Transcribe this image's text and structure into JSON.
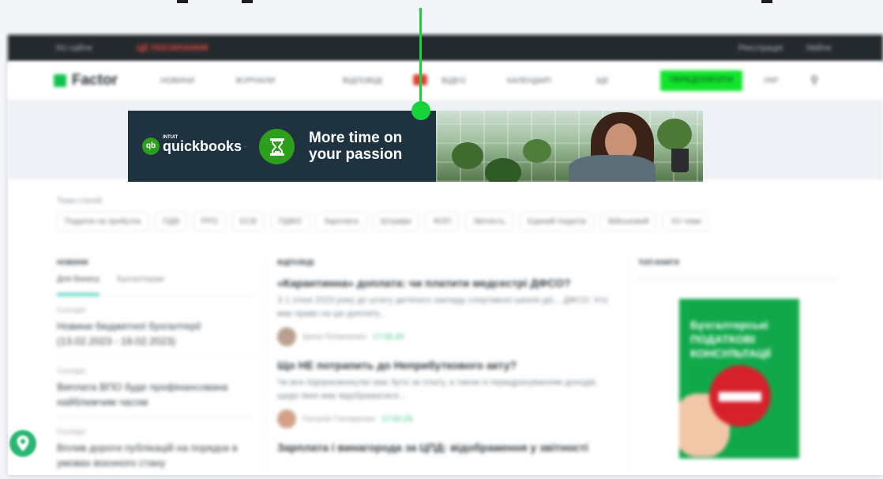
{
  "topbar": {
    "site_menu": "Усі сайти",
    "promo": "ЦЕ ПОСИЛАННЯ",
    "register": "Реєстрація",
    "login": "Увійти"
  },
  "nav": {
    "logo": "Factor",
    "items": [
      "НОВИНИ",
      "ЖУРНАЛИ",
      "ВІДПОВІДІ",
      "ВІДЕО",
      "КАЛЕНДАРІ",
      "ЩЕ"
    ],
    "cta": "ПЕРЕДПЛАТИТИ",
    "lang": "УКР"
  },
  "banner": {
    "brand_intuit": "INTUIT",
    "brand_name": "quickbooks",
    "brand_mark": "qb",
    "headline_line1": "More time on",
    "headline_line2": "your passion",
    "accent": "#2ca01c",
    "background": "#1f3240"
  },
  "tags": {
    "title": "Теми статей",
    "items": [
      "Податок на прибуток",
      "ПДВ",
      "РРО",
      "ЄСВ",
      "ПДФО",
      "Зарплата",
      "Штрафи",
      "ФОП",
      "Звітність",
      "Єдиний податок",
      "Військовий",
      "Усі теми"
    ]
  },
  "news": {
    "title": "НОВИНИ",
    "tabs": [
      "Для бізнесу",
      "Бухгалтерам"
    ],
    "items": [
      {
        "time": "Сьогодні",
        "text": "Новини бюджетної бухгалтерії (13.02.2023 - 19.02.2023)"
      },
      {
        "time": "Сьогодні",
        "text": "Виплата ВПО буде профінансована найближчим часом"
      },
      {
        "time": "Сьогодні",
        "text": "Вплив дороги публікацій на порядок в умовах воєнного стану"
      }
    ]
  },
  "answers": {
    "title": "ВІДПОВІДІ",
    "items": [
      {
        "q": "«Карантинна» доплата: чи платити медсестрі ДФСО?",
        "desc": "З 1 січня 2023 року до штату дитячого закладу спортивної школи діє... ДФСО: Хто має право на цю доплату...",
        "author": "Ірина Логвиненко",
        "date": "17.02.23"
      },
      {
        "q": "Що НЕ потрапить до Неприбуткового акту?",
        "desc": "Чи все підприємництво має бути за плату, а також із передрахуванням доходів, щодо яких має відображатися...",
        "author": "Наталія Гончаренко",
        "date": "17.02.23"
      },
      {
        "q": "Зарплата і винагорода за ЦПД: відображення у звітності",
        "desc": "",
        "author": "",
        "date": ""
      }
    ]
  },
  "sidebar_ad": {
    "title": "ТОП-КНИГИ",
    "book_title": "Бухгалтерські ПОДАТКОВІ КОНСУЛЬТАЦІЇ"
  }
}
